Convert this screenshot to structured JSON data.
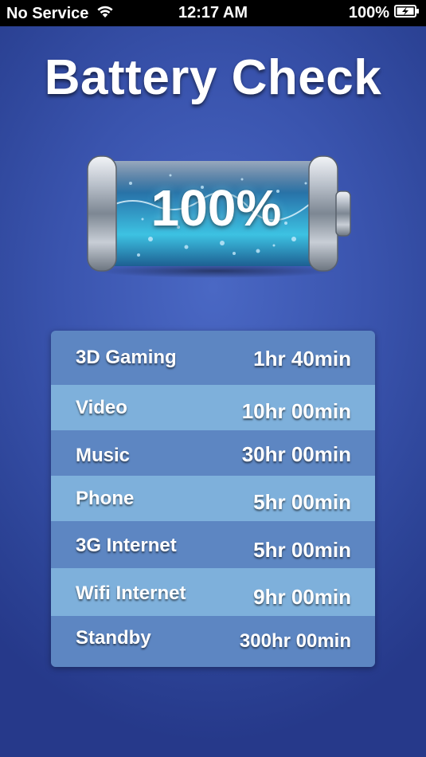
{
  "status_bar": {
    "carrier": "No Service",
    "time": "12:17 AM",
    "battery_percent": "100%",
    "wifi_icon": "wifi-icon",
    "battery_icon": "battery-charging-icon"
  },
  "app": {
    "title": "Battery Check"
  },
  "battery": {
    "level_text": "100%",
    "level_fraction": 1.0
  },
  "usage": {
    "rows": [
      {
        "label": "3D Gaming",
        "value": "1hr 40min"
      },
      {
        "label": "Video",
        "value": "10hr 00min"
      },
      {
        "label": "Music",
        "value": "30hr 00min"
      },
      {
        "label": "Phone",
        "value": "5hr 00min"
      },
      {
        "label": "3G Internet",
        "value": "5hr 00min"
      },
      {
        "label": "Wifi Internet",
        "value": "9hr 00min"
      },
      {
        "label": "Standby",
        "value": "300hr 00min"
      }
    ]
  },
  "colors": {
    "background": "#3a54ae",
    "row_dark": "#5d86c2",
    "row_light": "#7eb0db",
    "status_bar": "#000000"
  }
}
